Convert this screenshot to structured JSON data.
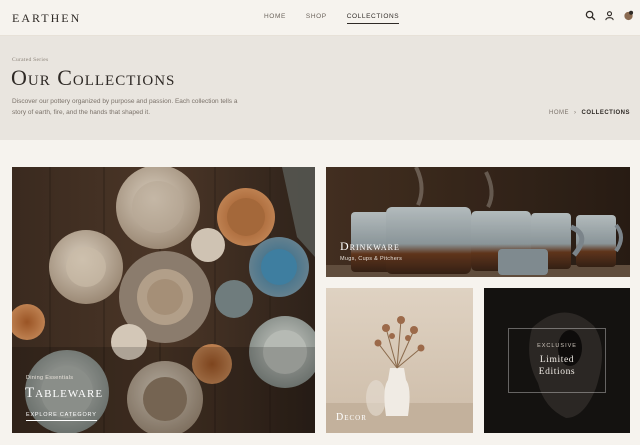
{
  "header": {
    "logo": "EARTHEN",
    "nav": [
      {
        "label": "HOME"
      },
      {
        "label": "SHOP"
      },
      {
        "label": "COLLECTIONS"
      }
    ]
  },
  "hero": {
    "eyebrow": "Curated Series",
    "title": "Our Collections",
    "description": "Discover our pottery organized by purpose and passion. Each collection tells a story of earth, fire, and the hands that shaped it.",
    "breadcrumb": {
      "home": "HOME",
      "current": "COLLECTIONS"
    }
  },
  "tiles": {
    "tableware": {
      "eyebrow": "Dining Essentials",
      "title": "Tableware",
      "cta": "EXPLORE CATEGORY"
    },
    "drinkware": {
      "title": "Drinkware",
      "subtitle": "Mugs, Cups & Pitchers"
    },
    "decor": {
      "title": "Decor"
    },
    "limited": {
      "eyebrow": "EXCLUSIVE",
      "title": "Limited Editions"
    }
  },
  "colors": {
    "accent": "#2f2a26",
    "hero_bg": "#e9e5df",
    "page_bg": "#f6f3ee"
  }
}
